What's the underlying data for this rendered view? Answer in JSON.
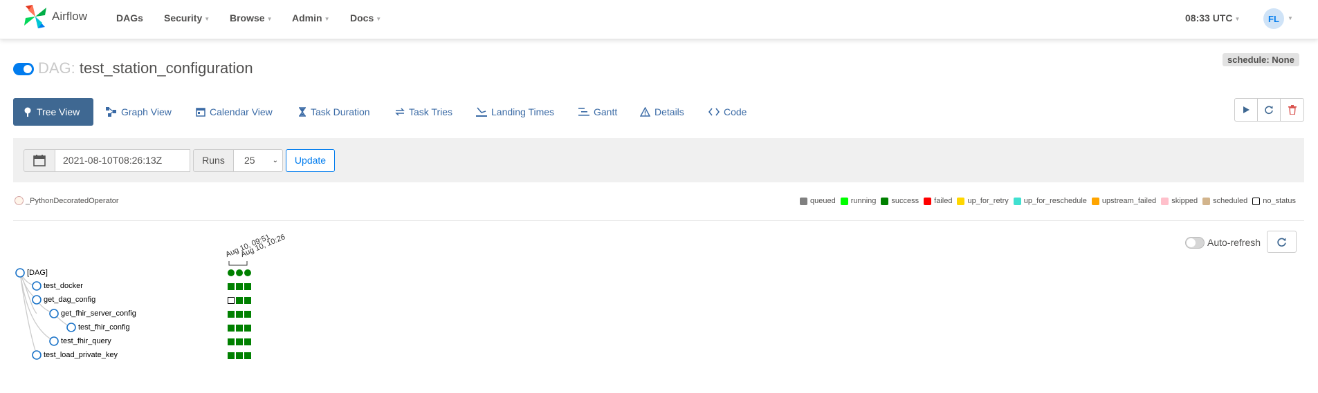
{
  "navbar": {
    "brand": "Airflow",
    "items": [
      {
        "label": "DAGs",
        "caret": false
      },
      {
        "label": "Security",
        "caret": true
      },
      {
        "label": "Browse",
        "caret": true
      },
      {
        "label": "Admin",
        "caret": true
      },
      {
        "label": "Docs",
        "caret": true
      }
    ],
    "time": "08:33 UTC",
    "user_initials": "FL"
  },
  "dag": {
    "label": "DAG:",
    "id": "test_station_configuration",
    "schedule": "schedule: None",
    "paused": false
  },
  "tabs": [
    {
      "label": "Tree View",
      "icon": "tree-icon",
      "active": true
    },
    {
      "label": "Graph View",
      "icon": "graph-icon",
      "active": false
    },
    {
      "label": "Calendar View",
      "icon": "calendar-icon",
      "active": false
    },
    {
      "label": "Task Duration",
      "icon": "hourglass-icon",
      "active": false
    },
    {
      "label": "Task Tries",
      "icon": "tries-icon",
      "active": false
    },
    {
      "label": "Landing Times",
      "icon": "landing-icon",
      "active": false
    },
    {
      "label": "Gantt",
      "icon": "gantt-icon",
      "active": false
    },
    {
      "label": "Details",
      "icon": "details-icon",
      "active": false
    },
    {
      "label": "Code",
      "icon": "code-icon",
      "active": false
    }
  ],
  "form": {
    "base_date": "2021-08-10T08:26:13Z",
    "runs_label": "Runs",
    "runs_value": "25",
    "update_label": "Update"
  },
  "operator_legend": "_PythonDecoratedOperator",
  "status_legend": [
    {
      "label": "queued",
      "color": "#808080",
      "outline": false
    },
    {
      "label": "running",
      "color": "#00ff00",
      "outline": false
    },
    {
      "label": "success",
      "color": "#008000",
      "outline": false
    },
    {
      "label": "failed",
      "color": "#ff0000",
      "outline": false
    },
    {
      "label": "up_for_retry",
      "color": "#ffd700",
      "outline": false
    },
    {
      "label": "up_for_reschedule",
      "color": "#40e0d0",
      "outline": false
    },
    {
      "label": "upstream_failed",
      "color": "#ffa500",
      "outline": false
    },
    {
      "label": "skipped",
      "color": "#ffc0cb",
      "outline": false
    },
    {
      "label": "scheduled",
      "color": "#d2b48c",
      "outline": false
    },
    {
      "label": "no_status",
      "color": "#ffffff",
      "outline": true
    }
  ],
  "auto_refresh_label": "Auto-refresh",
  "tree": {
    "dates": [
      "Aug 10, 09:51",
      "Aug 10, 10:26"
    ],
    "root": "[DAG]",
    "tasks": [
      {
        "name": "test_docker",
        "depth": 1,
        "statuses": [
          "success",
          "success",
          "success"
        ]
      },
      {
        "name": "get_dag_config",
        "depth": 1,
        "statuses": [
          "no_status",
          "success",
          "success"
        ]
      },
      {
        "name": "get_fhir_server_config",
        "depth": 2,
        "statuses": [
          "success",
          "success",
          "success"
        ]
      },
      {
        "name": "test_fhir_config",
        "depth": 3,
        "statuses": [
          "success",
          "success",
          "success"
        ]
      },
      {
        "name": "test_fhir_query",
        "depth": 2,
        "statuses": [
          "success",
          "success",
          "success"
        ]
      },
      {
        "name": "test_load_private_key",
        "depth": 1,
        "statuses": [
          "success",
          "success",
          "success"
        ]
      }
    ]
  }
}
